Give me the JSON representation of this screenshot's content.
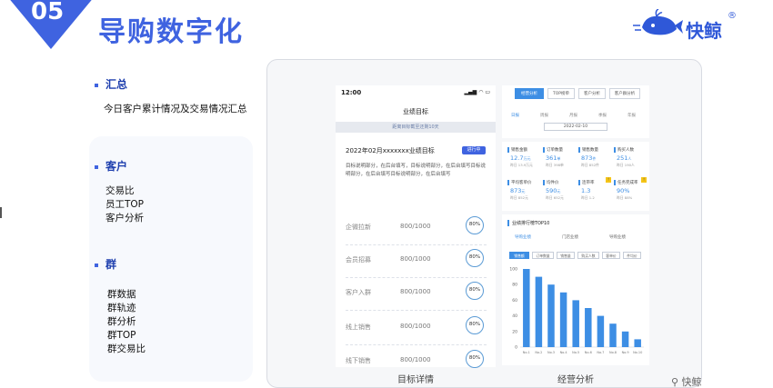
{
  "slide": {
    "number": "05",
    "title": "导购数字化",
    "brand": "快鲸",
    "brand_mark": "®",
    "watermark": "⚲ 快鲸",
    "colors": {
      "primary": "#3f63e0",
      "chart_blue": "#3d8ee4"
    }
  },
  "summary": {
    "title": "汇总",
    "text": "今日客户累计情况及交易情况汇总"
  },
  "customer": {
    "title": "客户",
    "items": [
      "交易比",
      "员工TOP",
      "客户分析"
    ]
  },
  "group": {
    "title": "群",
    "items": [
      "群数据",
      "群轨迹",
      "群分析",
      "群TOP",
      "群交易比"
    ]
  },
  "phone": {
    "time": "12:00",
    "status_icons": "▂▄▆ ◠ ▭",
    "title": "业绩目标",
    "banner": "距离目标截至还剩10天",
    "goal": "2022年02月xxxxxxx业绩目标",
    "goal_tag": "进行中",
    "desc": "目标说明部分，在后台填写，目标说明部分，在后台填写目标说明部分，在后台填写目标说明部分，在后台填写",
    "metrics": [
      {
        "label": "企微拉新",
        "value": "800/1000",
        "pct": "80%"
      },
      {
        "label": "会员招募",
        "value": "800/1000",
        "pct": "80%"
      },
      {
        "label": "客户入群",
        "value": "800/1000",
        "pct": "80%"
      },
      {
        "label": "线上销售",
        "value": "800/1000",
        "pct": "80%"
      },
      {
        "label": "线下销售",
        "value": "800/1000",
        "pct": "80%"
      }
    ],
    "caption": "目标详情"
  },
  "panel": {
    "tabs": [
      "经营分析",
      "TOP榜单",
      "客户分析",
      "客户群分析"
    ],
    "periods": [
      "日报",
      "周报",
      "月报",
      "季报",
      "年报"
    ],
    "date": "2022-02-10",
    "stats": [
      {
        "label": "销售金额",
        "value": "12.7",
        "unit": "万元",
        "sub": "昨日 13.9万元"
      },
      {
        "label": "订单数量",
        "value": "361",
        "unit": "单",
        "sub": "昨日 398单"
      },
      {
        "label": "销售数量",
        "value": "873",
        "unit": "件",
        "sub": "昨日 852件"
      },
      {
        "label": "购买人数",
        "value": "251",
        "unit": "人",
        "sub": "昨日 190人"
      },
      {
        "label": "平均客单价",
        "value": "873",
        "unit": "元",
        "sub": "昨日 852元"
      },
      {
        "label": "均件价",
        "value": "590",
        "unit": "元",
        "sub": "昨日 652元"
      },
      {
        "label": "连带率",
        "value": "1.3",
        "unit": "",
        "sub": "昨日 1.2",
        "flag": "!"
      },
      {
        "label": "任务完成率",
        "value": "90%",
        "unit": "",
        "sub": "昨日 88%",
        "flag": "!"
      }
    ],
    "ranking": {
      "title": "业绩排行榜TOP10",
      "tabs": [
        "导购业绩",
        "门店业绩",
        "导购业绩"
      ],
      "chips": [
        "销售额",
        "订单数量",
        "销售量",
        "购买人数",
        "客单价",
        "件均价"
      ]
    },
    "caption": "经营分析"
  },
  "chart_data": {
    "type": "bar",
    "title": "业绩排行榜TOP10",
    "ylim": [
      0,
      100
    ],
    "yticks": [
      0,
      20,
      40,
      60,
      80,
      100
    ],
    "categories": [
      "No.1",
      "No.2",
      "No.3",
      "No.4",
      "No.5",
      "No.6",
      "No.7",
      "No.8",
      "No.9",
      "No.10"
    ],
    "values": [
      100,
      90,
      80,
      70,
      60,
      50,
      40,
      30,
      20,
      10
    ],
    "color": "#3d8ee4",
    "grid": false
  }
}
